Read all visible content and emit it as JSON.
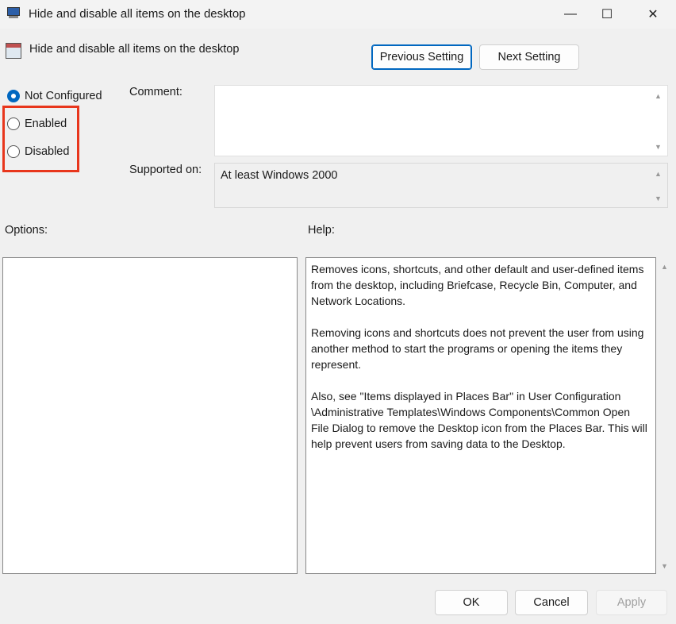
{
  "window": {
    "title": "Hide and disable all items on the desktop",
    "minimize": "—",
    "maximize": "☐",
    "close": "✕"
  },
  "header": {
    "setting_name": "Hide and disable all items on the desktop",
    "previous": "Previous Setting",
    "next": "Next Setting"
  },
  "state": {
    "options": [
      {
        "label": "Not Configured",
        "selected": true
      },
      {
        "label": "Enabled",
        "selected": false
      },
      {
        "label": "Disabled",
        "selected": false
      }
    ],
    "highlight_color": "#e8361c"
  },
  "comment": {
    "label": "Comment:",
    "value": ""
  },
  "supported": {
    "label": "Supported on:",
    "value": "At least Windows 2000"
  },
  "options_label": "Options:",
  "help": {
    "label": "Help:",
    "paragraphs": [
      "Removes icons, shortcuts, and other default and user-defined items from the desktop, including Briefcase, Recycle Bin, Computer, and Network Locations.",
      "Removing icons and shortcuts does not prevent the user from using another method to start the programs or opening the items they represent.",
      "Also, see \"Items displayed in Places Bar\" in User Configuration \\Administrative Templates\\Windows Components\\Common Open File Dialog to remove the Desktop icon from the Places Bar. This will help prevent users from saving data to the Desktop."
    ]
  },
  "footer": {
    "ok": "OK",
    "cancel": "Cancel",
    "apply": "Apply"
  }
}
